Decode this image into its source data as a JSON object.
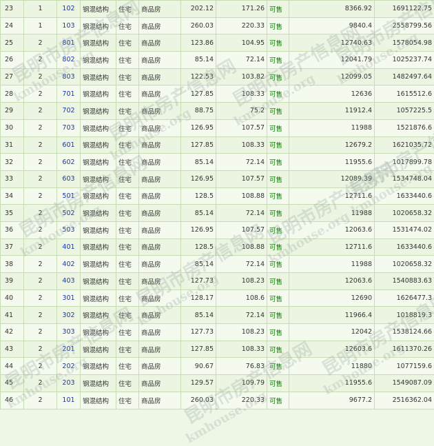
{
  "rows": [
    {
      "seq": "23",
      "floor": "1",
      "room": "102",
      "structure": "钢混结构",
      "use": "住宅",
      "type": "商品房",
      "area": "202.12",
      "inner_area": "171.26",
      "status": "可售",
      "unit_price": "8366.92",
      "total_price": "1691122.75"
    },
    {
      "seq": "24",
      "floor": "1",
      "room": "103",
      "structure": "钢混结构",
      "use": "住宅",
      "type": "商品房",
      "area": "260.03",
      "inner_area": "220.33",
      "status": "可售",
      "unit_price": "9840.4",
      "total_price": "2558799.56"
    },
    {
      "seq": "25",
      "floor": "2",
      "room": "801",
      "structure": "钢混结构",
      "use": "住宅",
      "type": "商品房",
      "area": "123.86",
      "inner_area": "104.95",
      "status": "可售",
      "unit_price": "12740.63",
      "total_price": "1578054.98"
    },
    {
      "seq": "26",
      "floor": "2",
      "room": "802",
      "structure": "钢混结构",
      "use": "住宅",
      "type": "商品房",
      "area": "85.14",
      "inner_area": "72.14",
      "status": "可售",
      "unit_price": "12041.79",
      "total_price": "1025237.74"
    },
    {
      "seq": "27",
      "floor": "2",
      "room": "803",
      "structure": "钢混结构",
      "use": "住宅",
      "type": "商品房",
      "area": "122.53",
      "inner_area": "103.82",
      "status": "可售",
      "unit_price": "12099.05",
      "total_price": "1482497.64"
    },
    {
      "seq": "28",
      "floor": "2",
      "room": "701",
      "structure": "钢混结构",
      "use": "住宅",
      "type": "商品房",
      "area": "127.85",
      "inner_area": "108.33",
      "status": "可售",
      "unit_price": "12636",
      "total_price": "1615512.6"
    },
    {
      "seq": "29",
      "floor": "2",
      "room": "702",
      "structure": "钢混结构",
      "use": "住宅",
      "type": "商品房",
      "area": "88.75",
      "inner_area": "75.2",
      "status": "可售",
      "unit_price": "11912.4",
      "total_price": "1057225.5"
    },
    {
      "seq": "30",
      "floor": "2",
      "room": "703",
      "structure": "钢混结构",
      "use": "住宅",
      "type": "商品房",
      "area": "126.95",
      "inner_area": "107.57",
      "status": "可售",
      "unit_price": "11988",
      "total_price": "1521876.6"
    },
    {
      "seq": "31",
      "floor": "2",
      "room": "601",
      "structure": "钢混结构",
      "use": "住宅",
      "type": "商品房",
      "area": "127.85",
      "inner_area": "108.33",
      "status": "可售",
      "unit_price": "12679.2",
      "total_price": "1621035.72"
    },
    {
      "seq": "32",
      "floor": "2",
      "room": "602",
      "structure": "钢混结构",
      "use": "住宅",
      "type": "商品房",
      "area": "85.14",
      "inner_area": "72.14",
      "status": "可售",
      "unit_price": "11955.6",
      "total_price": "1017899.78"
    },
    {
      "seq": "33",
      "floor": "2",
      "room": "603",
      "structure": "钢混结构",
      "use": "住宅",
      "type": "商品房",
      "area": "126.95",
      "inner_area": "107.57",
      "status": "可售",
      "unit_price": "12089.39",
      "total_price": "1534748.04"
    },
    {
      "seq": "34",
      "floor": "2",
      "room": "501",
      "structure": "钢混结构",
      "use": "住宅",
      "type": "商品房",
      "area": "128.5",
      "inner_area": "108.88",
      "status": "可售",
      "unit_price": "12711.6",
      "total_price": "1633440.6"
    },
    {
      "seq": "35",
      "floor": "2",
      "room": "502",
      "structure": "钢混结构",
      "use": "住宅",
      "type": "商品房",
      "area": "85.14",
      "inner_area": "72.14",
      "status": "可售",
      "unit_price": "11988",
      "total_price": "1020658.32"
    },
    {
      "seq": "36",
      "floor": "2",
      "room": "503",
      "structure": "钢混结构",
      "use": "住宅",
      "type": "商品房",
      "area": "126.95",
      "inner_area": "107.57",
      "status": "可售",
      "unit_price": "12063.6",
      "total_price": "1531474.02"
    },
    {
      "seq": "37",
      "floor": "2",
      "room": "401",
      "structure": "钢混结构",
      "use": "住宅",
      "type": "商品房",
      "area": "128.5",
      "inner_area": "108.88",
      "status": "可售",
      "unit_price": "12711.6",
      "total_price": "1633440.6"
    },
    {
      "seq": "38",
      "floor": "2",
      "room": "402",
      "structure": "钢混结构",
      "use": "住宅",
      "type": "商品房",
      "area": "85.14",
      "inner_area": "72.14",
      "status": "可售",
      "unit_price": "11988",
      "total_price": "1020658.32"
    },
    {
      "seq": "39",
      "floor": "2",
      "room": "403",
      "structure": "钢混结构",
      "use": "住宅",
      "type": "商品房",
      "area": "127.73",
      "inner_area": "108.23",
      "status": "可售",
      "unit_price": "12063.6",
      "total_price": "1540883.63"
    },
    {
      "seq": "40",
      "floor": "2",
      "room": "301",
      "structure": "钢混结构",
      "use": "住宅",
      "type": "商品房",
      "area": "128.17",
      "inner_area": "108.6",
      "status": "可售",
      "unit_price": "12690",
      "total_price": "1626477.3"
    },
    {
      "seq": "41",
      "floor": "2",
      "room": "302",
      "structure": "钢混结构",
      "use": "住宅",
      "type": "商品房",
      "area": "85.14",
      "inner_area": "72.14",
      "status": "可售",
      "unit_price": "11966.4",
      "total_price": "1018819.3"
    },
    {
      "seq": "42",
      "floor": "2",
      "room": "303",
      "structure": "钢混结构",
      "use": "住宅",
      "type": "商品房",
      "area": "127.73",
      "inner_area": "108.23",
      "status": "可售",
      "unit_price": "12042",
      "total_price": "1538124.66"
    },
    {
      "seq": "43",
      "floor": "2",
      "room": "201",
      "structure": "钢混结构",
      "use": "住宅",
      "type": "商品房",
      "area": "127.85",
      "inner_area": "108.33",
      "status": "可售",
      "unit_price": "12603.6",
      "total_price": "1611370.26"
    },
    {
      "seq": "44",
      "floor": "2",
      "room": "202",
      "structure": "钢混结构",
      "use": "住宅",
      "type": "商品房",
      "area": "90.67",
      "inner_area": "76.83",
      "status": "可售",
      "unit_price": "11880",
      "total_price": "1077159.6"
    },
    {
      "seq": "45",
      "floor": "2",
      "room": "203",
      "structure": "钢混结构",
      "use": "住宅",
      "type": "商品房",
      "area": "129.57",
      "inner_area": "109.79",
      "status": "可售",
      "unit_price": "11955.6",
      "total_price": "1549087.09"
    },
    {
      "seq": "46",
      "floor": "2",
      "room": "101",
      "structure": "钢混结构",
      "use": "住宅",
      "type": "商品房",
      "area": "260.03",
      "inner_area": "220.33",
      "status": "可售",
      "unit_price": "9677.2",
      "total_price": "2516362.04"
    }
  ],
  "watermark": {
    "cn": "昆明市房产信息网",
    "en": "kmhouse.org"
  }
}
